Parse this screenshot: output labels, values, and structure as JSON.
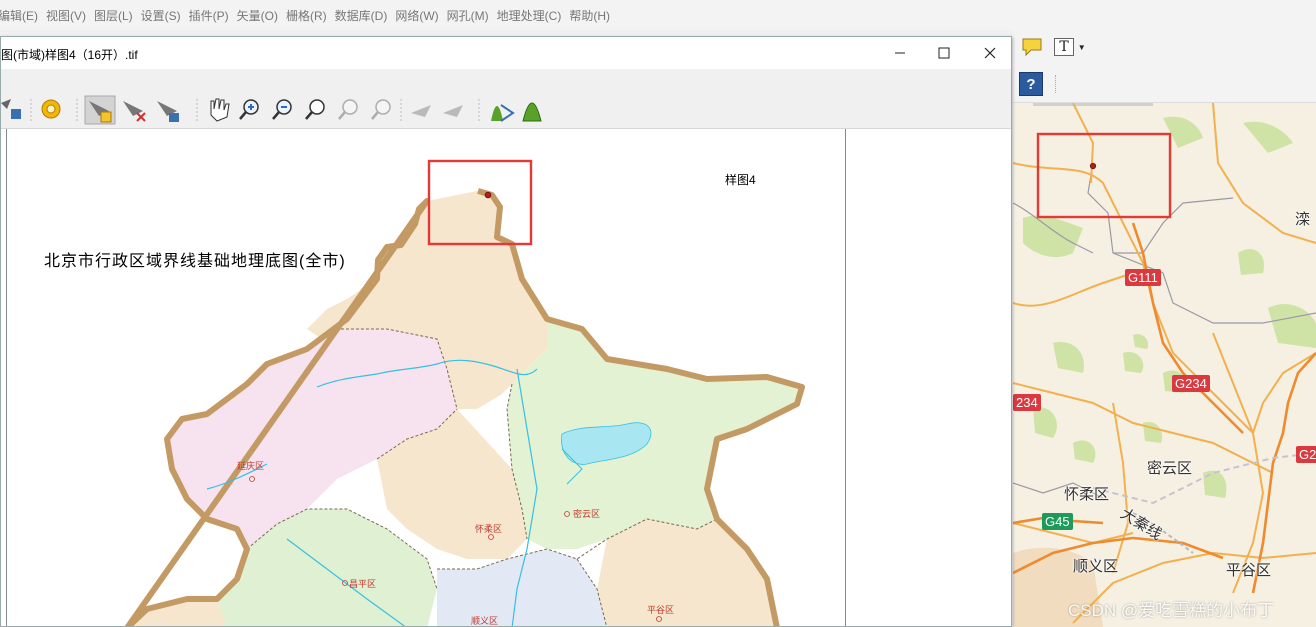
{
  "menu": [
    "编辑(E)",
    "视图(V)",
    "图层(L)",
    "设置(S)",
    "插件(P)",
    "矢量(O)",
    "栅格(R)",
    "数据库(D)",
    "网络(W)",
    "网孔(M)",
    "地理处理(C)",
    "帮助(H)"
  ],
  "main_toolbar": {
    "text_tool_label": "T"
  },
  "georef_window": {
    "title": "图(市域)样图4（16开）.tif",
    "minimize_label": "—",
    "maximize_label": "☐",
    "close_label": "✕"
  },
  "scanned_map": {
    "title": "北京市行政区域界线基础地理底图(全市)",
    "sheet_label": "样图4",
    "districts": [
      "延庆区",
      "怀柔区",
      "密云区",
      "昌平区",
      "顺义区",
      "平谷区"
    ]
  },
  "reference_map": {
    "districts": [
      "密云区",
      "怀柔区",
      "顺义区",
      "平谷区"
    ],
    "partial_labels": [
      "滦",
      "大秦线"
    ],
    "road_shields": [
      {
        "label": "G111",
        "color": "#d9393f"
      },
      {
        "label": "G234",
        "color": "#d9393f"
      },
      {
        "label": "234",
        "color": "#d9393f"
      },
      {
        "label": "G2",
        "color": "#d9393f"
      },
      {
        "label": "G45",
        "color": "#1e9a5a"
      }
    ]
  },
  "watermark": "CSDN @爱吃雪糕的小布丁",
  "colors": {
    "highlight_box": "#e53935",
    "gcp_point": "#c0392b",
    "boundary": "#c49a64"
  }
}
